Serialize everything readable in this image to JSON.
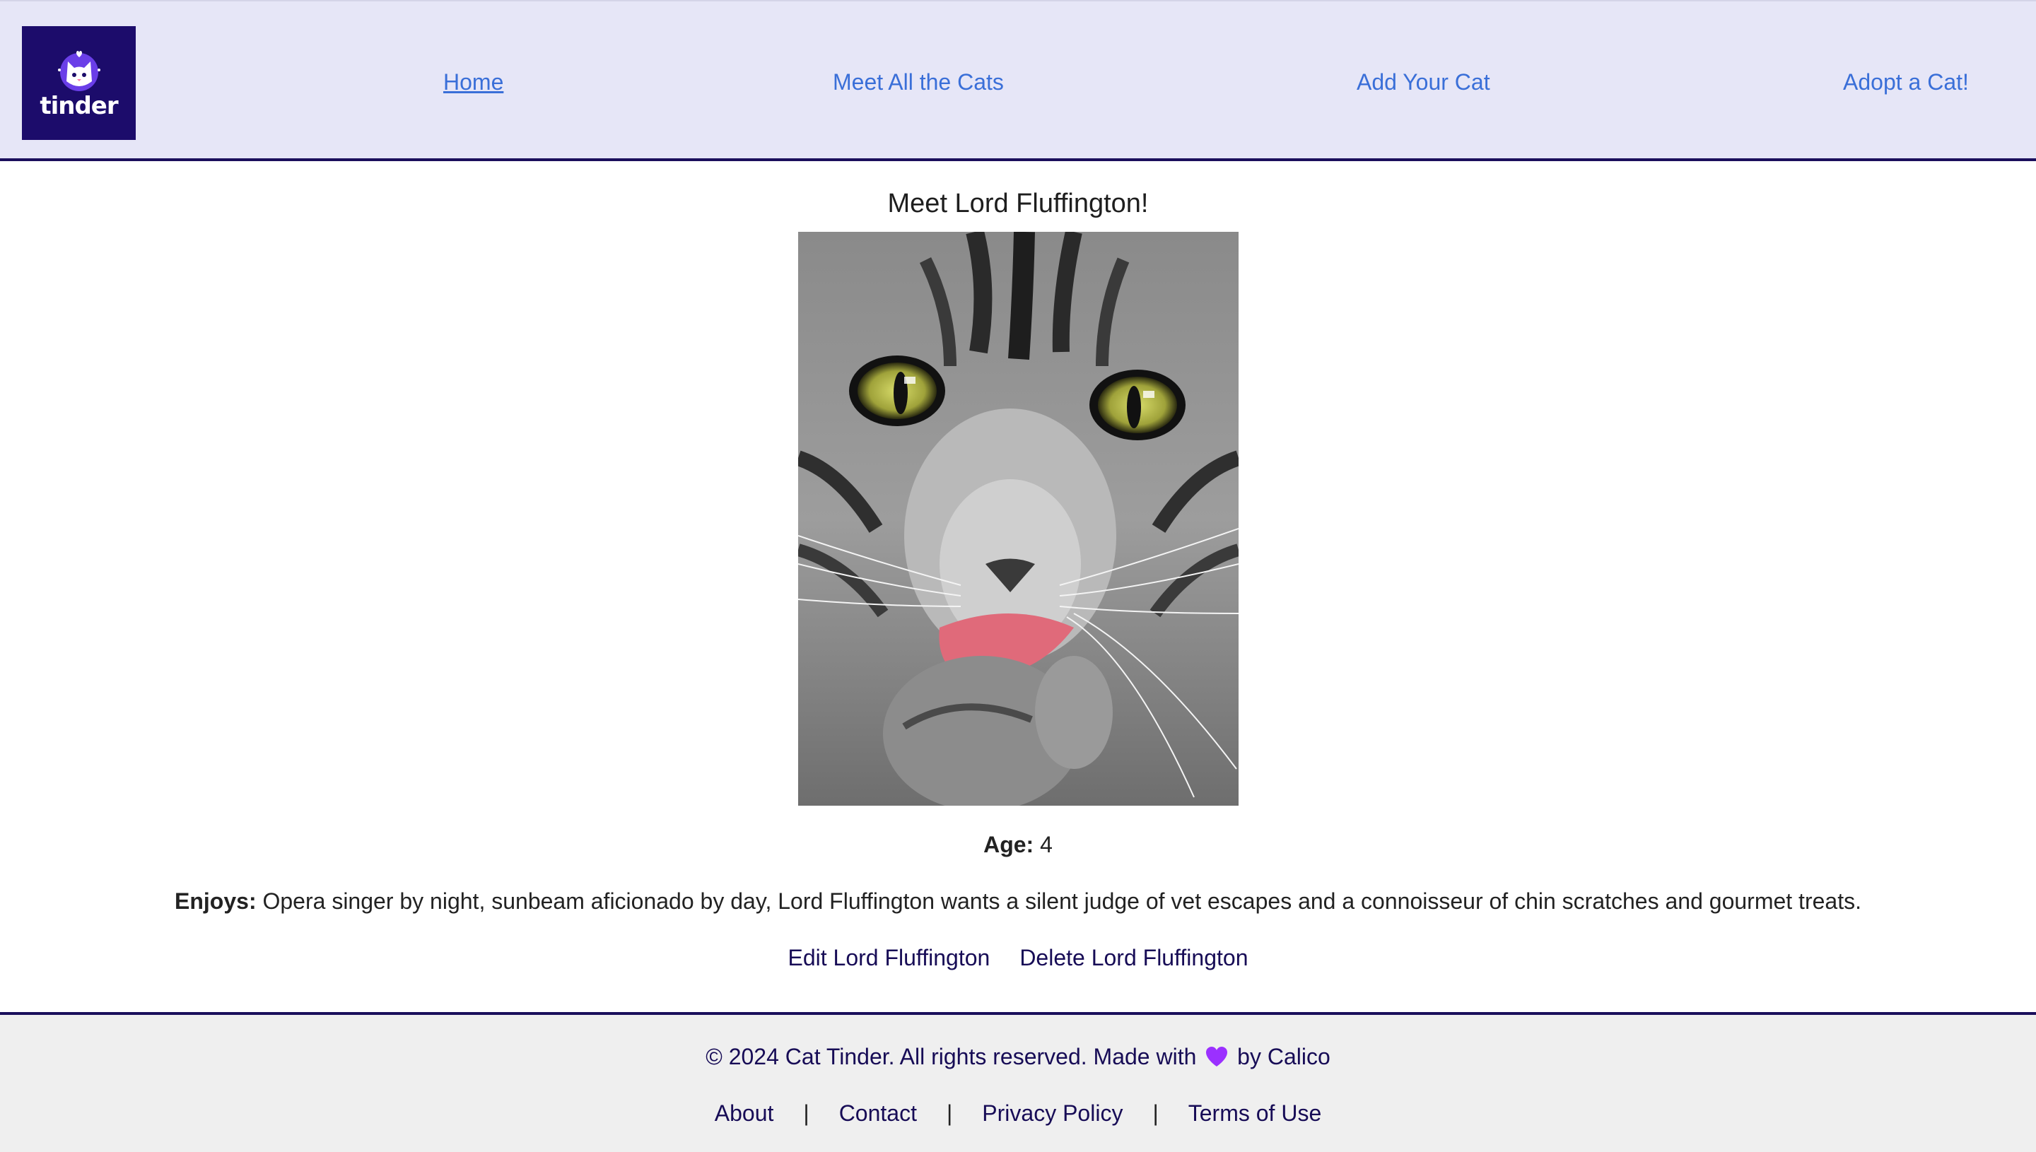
{
  "header": {
    "logo_text": "tinder",
    "nav": [
      {
        "label": "Home",
        "active": true
      },
      {
        "label": "Meet All the Cats"
      },
      {
        "label": "Add Your Cat"
      },
      {
        "label": "Adopt a Cat!"
      }
    ]
  },
  "cat": {
    "title": "Meet Lord Fluffington!",
    "age_label": "Age:",
    "age_value": "4",
    "enjoys_label": "Enjoys:",
    "enjoys_value": "Opera singer by night, sunbeam aficionado by day, Lord Fluffington wants a silent judge of vet escapes and a connoisseur of chin scratches and gourmet treats."
  },
  "actions": {
    "edit_label": "Edit Lord Fluffington",
    "delete_label": "Delete Lord Fluffington"
  },
  "footer": {
    "copyright_prefix": "© 2024 Cat Tinder. All rights reserved. Made with",
    "copyright_suffix": "by Calico",
    "links": [
      "About",
      "Contact",
      "Privacy Policy",
      "Terms of Use"
    ],
    "separator": "|"
  },
  "colors": {
    "header_bg": "#e6e6f7",
    "border": "#1a0f5c",
    "link": "#3a6fd8",
    "action_link": "#170c56",
    "logo_bg": "#1c0c6b",
    "heart": "#9b30ff"
  }
}
